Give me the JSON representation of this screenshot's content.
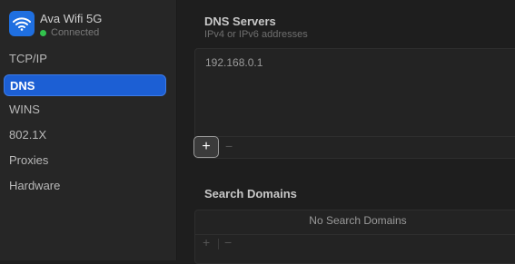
{
  "network": {
    "name": "Ava Wifi 5G",
    "status": "Connected",
    "status_color": "#32c24d",
    "icon": "wifi-icon"
  },
  "sidebar": {
    "items": [
      {
        "label": "TCP/IP",
        "active": false
      },
      {
        "label": "DNS",
        "active": true
      },
      {
        "label": "WINS",
        "active": false
      },
      {
        "label": "802.1X",
        "active": false
      },
      {
        "label": "Proxies",
        "active": false
      },
      {
        "label": "Hardware",
        "active": false
      }
    ],
    "accent": "#1c5fd4"
  },
  "dns": {
    "title": "DNS Servers",
    "subtitle": "IPv4 or IPv6 addresses",
    "servers": [
      "192.168.0.1"
    ],
    "add_label": "+",
    "remove_label": "−"
  },
  "search_domains": {
    "title": "Search Domains",
    "empty_text": "No Search Domains",
    "add_label": "+",
    "remove_label": "−"
  }
}
